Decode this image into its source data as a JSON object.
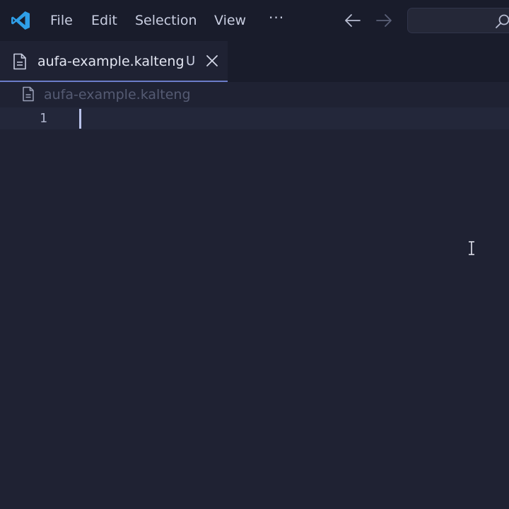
{
  "titlebar": {
    "menu": {
      "file": "File",
      "edit": "Edit",
      "selection": "Selection",
      "view": "View",
      "more": "···"
    },
    "icons": {
      "app": "vscode-logo-icon",
      "back": "arrow-left-icon",
      "forward": "arrow-right-icon",
      "search": "search-icon"
    }
  },
  "tab": {
    "label": "aufa-example.kalteng",
    "status": "U",
    "icon": "file-icon",
    "close_icon": "close-icon"
  },
  "breadcrumb": {
    "label": "aufa-example.kalteng",
    "icon": "file-icon"
  },
  "editor": {
    "line_numbers": [
      "1"
    ],
    "content": ""
  },
  "colors": {
    "background": "#1f2233",
    "titlebar": "#191c2b",
    "accent": "#6b7cc8",
    "logo": "#2f9fe8"
  }
}
